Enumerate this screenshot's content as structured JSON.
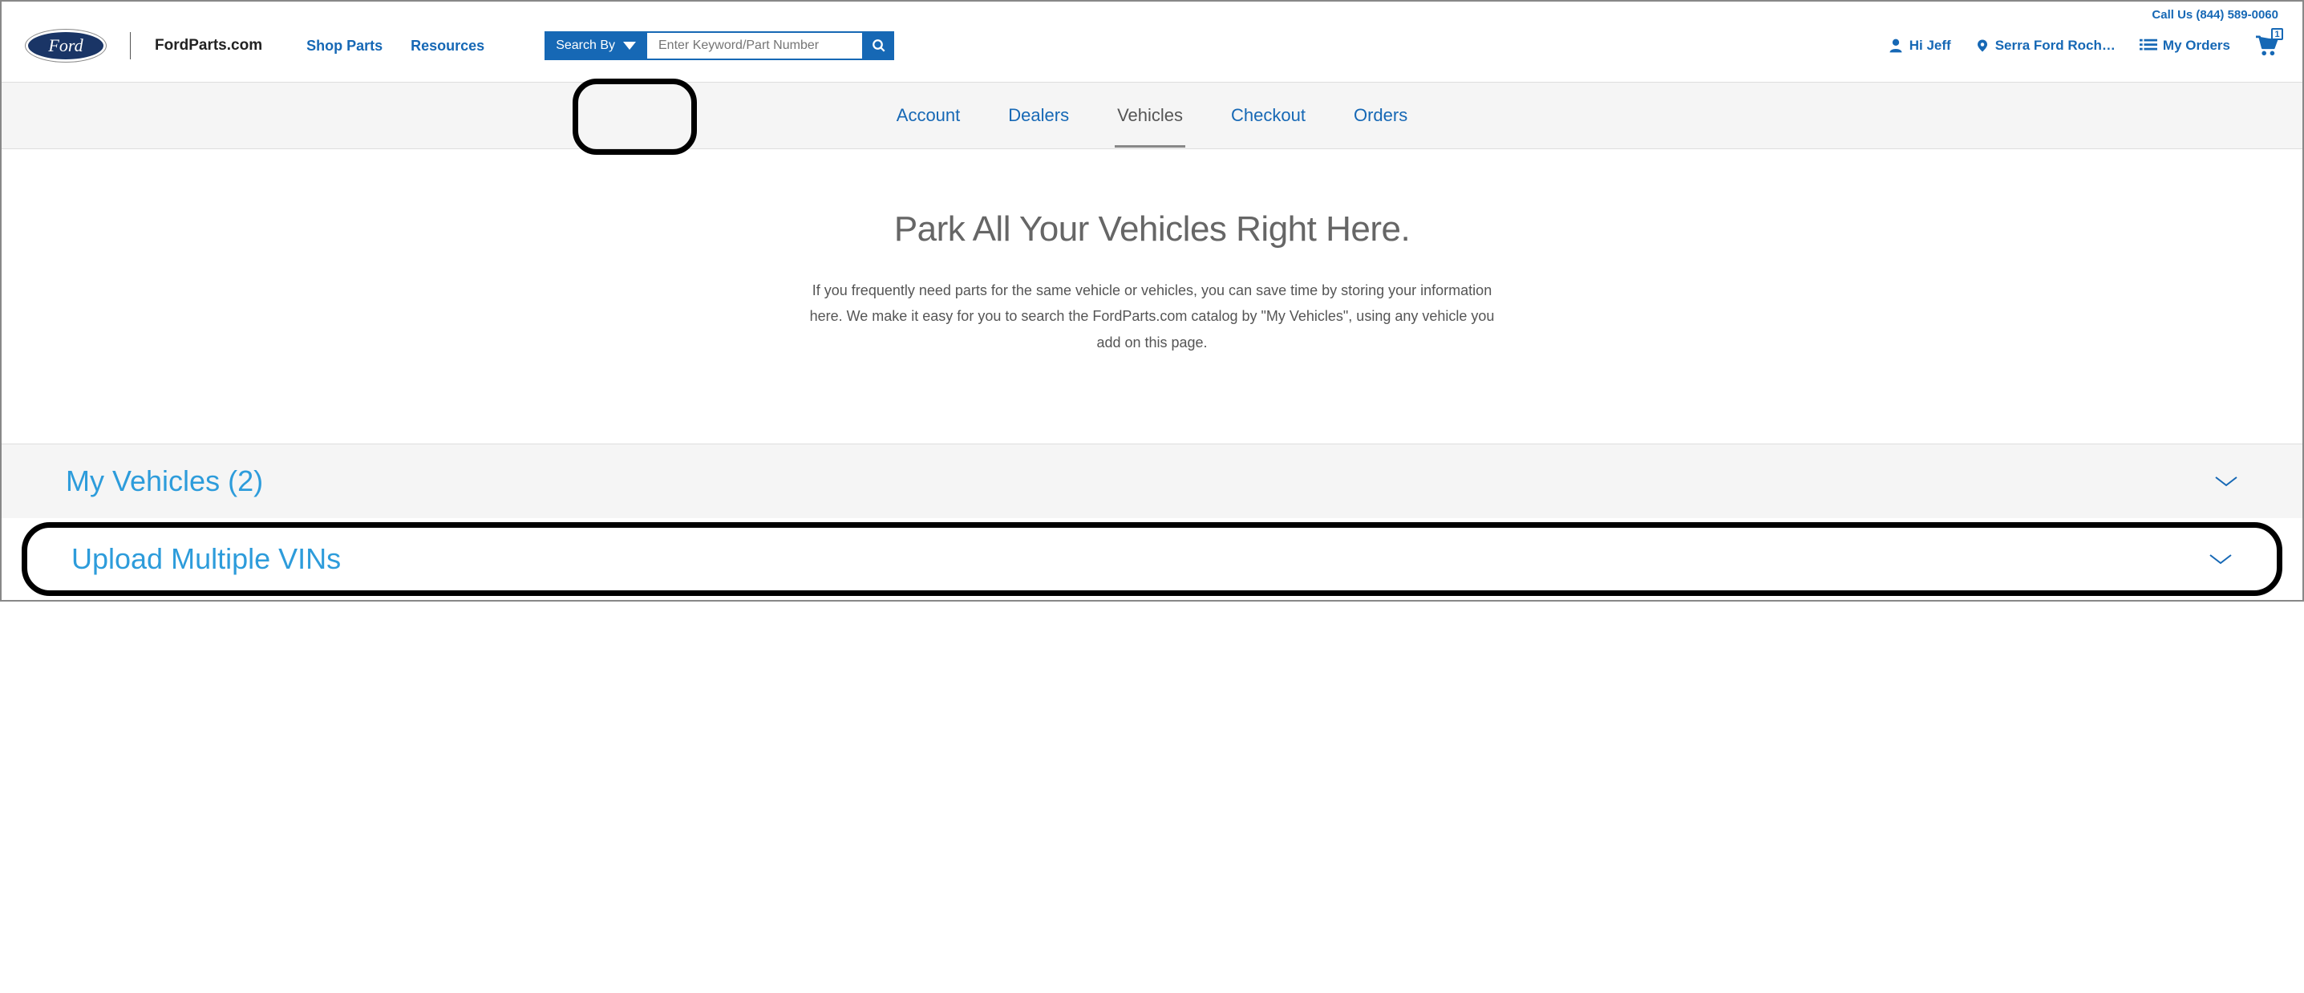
{
  "header": {
    "call_us": "Call Us (844) 589-0060",
    "site_name": "FordParts.com",
    "logo_text": "Ford",
    "nav": {
      "shop_parts": "Shop Parts",
      "resources": "Resources"
    },
    "search": {
      "search_by_label": "Search By",
      "placeholder": "Enter Keyword/Part Number"
    },
    "user_greeting": "Hi Jeff",
    "dealer": "Serra Ford Roch…",
    "my_orders": "My Orders",
    "cart_count": "1"
  },
  "tabs": {
    "account": "Account",
    "dealers": "Dealers",
    "vehicles": "Vehicles",
    "checkout": "Checkout",
    "orders": "Orders"
  },
  "hero": {
    "title": "Park All Your Vehicles Right Here.",
    "body": "If you frequently need parts for the same vehicle or vehicles, you can save time by storing your information here. We make it easy for you to search the FordParts.com catalog by \"My Vehicles\", using any vehicle you add on this page."
  },
  "accordions": {
    "my_vehicles": "My Vehicles (2)",
    "upload_vins": "Upload Multiple VINs"
  }
}
